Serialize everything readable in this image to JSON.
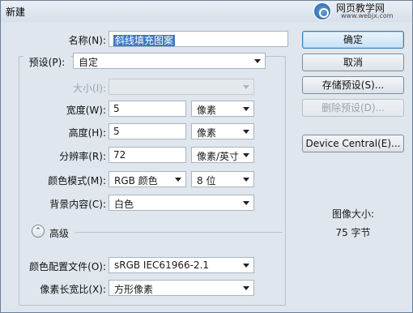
{
  "window": {
    "title": "新建",
    "watermark_text": "网页教学网",
    "watermark_url": "www.webjx.com"
  },
  "form": {
    "name": {
      "label": "名称(N):",
      "value": "斜线填充图案"
    },
    "preset": {
      "label": "预设(P):",
      "value": "自定"
    },
    "size": {
      "label": "大小(I):",
      "value": ""
    },
    "width": {
      "label": "宽度(W):",
      "value": "5",
      "unit": "像素"
    },
    "height": {
      "label": "高度(H):",
      "value": "5",
      "unit": "像素"
    },
    "resolution": {
      "label": "分辨率(R):",
      "value": "72",
      "unit": "像素/英寸"
    },
    "color_mode": {
      "label": "颜色模式(M):",
      "value": "RGB 颜色",
      "depth": "8 位"
    },
    "background": {
      "label": "背景内容(C):",
      "value": "白色"
    },
    "advanced": {
      "label": "高级",
      "toggle_glyph": "⌃"
    },
    "color_profile": {
      "label": "颜色配置文件(O):",
      "value": "sRGB IEC61966-2.1"
    },
    "pixel_aspect": {
      "label": "像素长宽比(X):",
      "value": "方形像素"
    }
  },
  "buttons": {
    "ok": "确定",
    "cancel": "取消",
    "save_preset": "存储预设(S)...",
    "delete_preset": "删除预设(D)...",
    "device_central": "Device Central(E)..."
  },
  "image_size": {
    "title": "图像大小:",
    "value": "75 字节"
  }
}
